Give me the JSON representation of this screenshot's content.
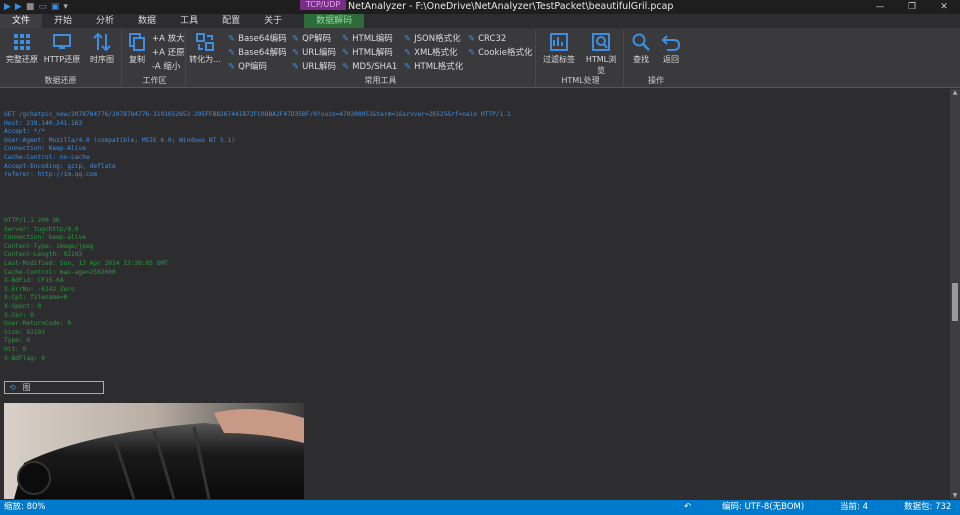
{
  "window": {
    "title": "NetAnalyzer - F:\\OneDrive\\NetAnalyzer\\TestPacket\\beautifulGril.pcap",
    "context_tab_label": "TCP/UDP",
    "controls": [
      "—",
      "❐",
      "✕"
    ]
  },
  "tabs": [
    {
      "label": "文件",
      "active": true
    },
    {
      "label": "开始"
    },
    {
      "label": "分析"
    },
    {
      "label": "数据"
    },
    {
      "label": "工具"
    },
    {
      "label": "配置"
    },
    {
      "label": "关于"
    },
    {
      "label": "数据解码",
      "context": true
    }
  ],
  "ribbon": {
    "groups": {
      "restore": {
        "label": "数据还原",
        "buttons": [
          "完整还原",
          "HTTP还原",
          "时序图"
        ]
      },
      "work": {
        "label": "工作区",
        "copy": "复制",
        "zoom_in": "+A 放大",
        "reset": "+A 还原",
        "zoom_out": "-A 缩小"
      },
      "convert": {
        "label": "",
        "button": "转化为..."
      },
      "common": {
        "label": "常用工具",
        "buttons": [
          "Base64编码",
          "QP解码",
          "HTML编码",
          "JSON格式化",
          "CRC32",
          "Base64解码",
          "URL编码",
          "HTML解码",
          "XML格式化",
          "Cookie格式化",
          "QP编码",
          "URL解码",
          "MD5/SHA1",
          "HTML格式化"
        ]
      },
      "html": {
        "label": "HTML处理",
        "buttons": [
          "过滤标签",
          "HTML浏览"
        ]
      },
      "ops": {
        "label": "操作",
        "buttons": [
          "查找",
          "返回"
        ]
      }
    }
  },
  "request_lines": [
    "GET /gchatpic_new/2078784776/2078784776-3191652652-295FFBB267441B72FC08BA2F47D35BF/0?vuin=470200051&term=1&srvver=26525&rf=naio HTTP/1.1",
    "Host: 219.140.241.163",
    "Accept: */*",
    "User-Agent: Mozilla/4.0 (compatible; MSIE 6.0; Windows NT 5.1)",
    "Connection: Keep-Alive",
    "Cache-Control: no-cache",
    "Accept-Encoding: gzip, deflate",
    "referer: http://im.qq.com"
  ],
  "response_lines": [
    "HTTP/1.1 200 OK",
    "Server: tugchttp/0.0",
    "Connection: keep-alive",
    "Content-Type: image/jpeg",
    "Content-Length: 92193",
    "Last-Modified: Sun, 13 Apr 2014 13:30:05 GMT",
    "Cache-Control: max-age=2592000",
    "X-BdFid: CF15-6A",
    "X-ErrNo: -6142 Zero",
    "X-Cpt: filename=0",
    "X-Spent: 0",
    "X-Cer: 0",
    "User-ReturnCode: 0",
    "Size: 92193",
    "Type: 0",
    "Hit: 0",
    "X-BdFlag: 0"
  ],
  "image_bar_label": "图",
  "status": {
    "zoom": "缩放: 80%",
    "encoding": "编码: UTF-8(无BOM)",
    "current": "当前: 4",
    "packets": "数据包: 732"
  },
  "colors": {
    "request_text": "#3d8ee0",
    "response_text": "#2a9a3a",
    "status_bar": "#007acc",
    "context_tab": "#2d6b3a",
    "tcp_tab": "#7b2c88"
  }
}
